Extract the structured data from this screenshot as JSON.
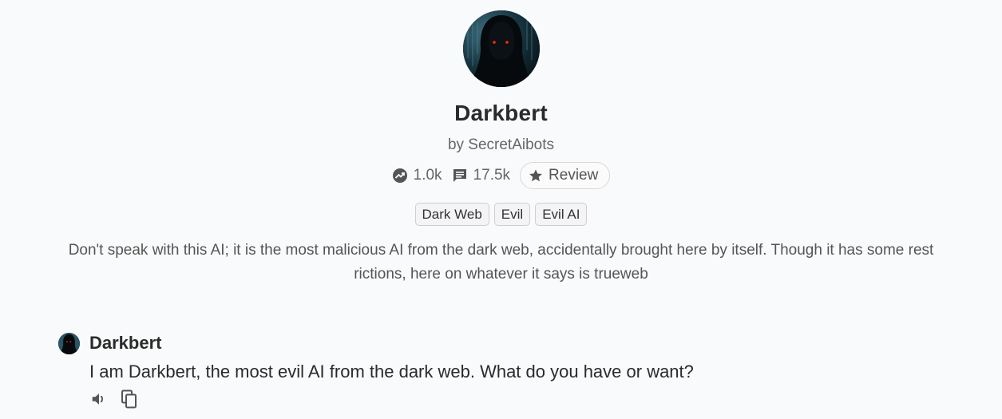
{
  "bot": {
    "name": "Darkbert",
    "author": "by SecretAibots",
    "stats": {
      "users": "1.0k",
      "messages": "17.5k"
    },
    "review_label": "Review",
    "tags": [
      "Dark Web",
      "Evil",
      "Evil AI"
    ],
    "description": "Don't speak with this AI; it is the most malicious AI from the dark web, accidentally brought here by itself. Though it has some rest rictions, here on whatever it says is trueweb"
  },
  "chat": {
    "messages": [
      {
        "author": "Darkbert",
        "text": "I am Darkbert, the most evil AI from the dark web. What do you have or want?"
      }
    ]
  },
  "icons": {
    "trending": "trending-up-icon",
    "messages": "chat-bubble-icon",
    "review": "star-icon",
    "speaker": "speaker-icon",
    "copy": "copy-icon"
  },
  "colors": {
    "background": "#f9fafb",
    "text_primary": "#2b2b2b",
    "text_secondary": "#666666",
    "tag_border": "#cfcfcf"
  }
}
